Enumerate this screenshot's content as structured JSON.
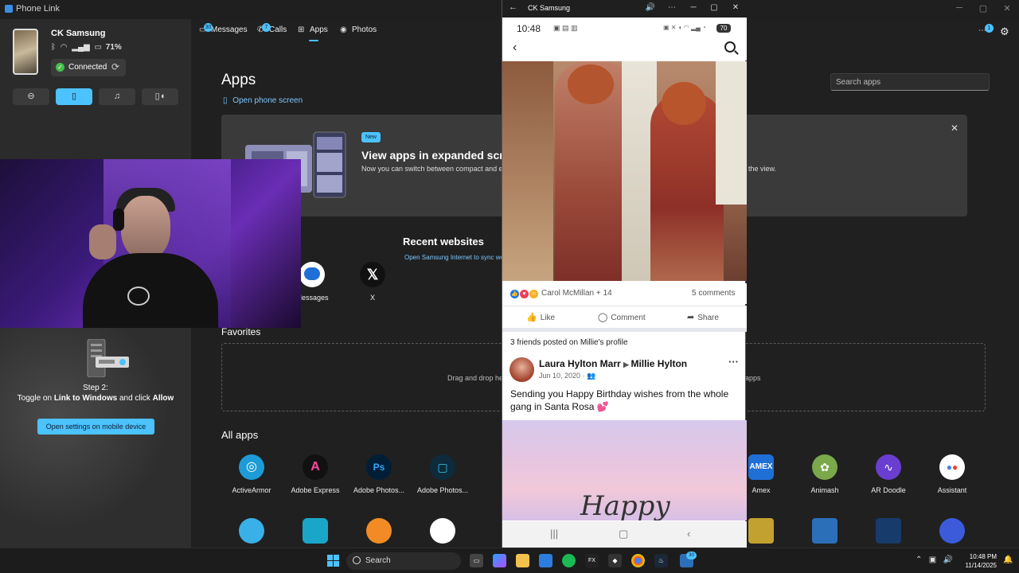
{
  "window": {
    "title": "Phone Link"
  },
  "device": {
    "name": "CK Samsung",
    "battery": "71%",
    "status": "Connected"
  },
  "nav": {
    "messages": "Messages",
    "messages_badge": "30",
    "calls": "Calls",
    "calls_badge": "7",
    "apps": "Apps",
    "photos": "Photos",
    "notif_badge": "1"
  },
  "setup": {
    "step_title": "Step 2:",
    "step_pre": "Toggle on ",
    "step_bold1": "Link to Windows",
    "step_mid": " and click ",
    "step_bold2": "Allow",
    "button": "Open settings on mobile device"
  },
  "main": {
    "title": "Apps",
    "open_phone_screen": "Open phone screen",
    "search_placeholder": "Search apps",
    "banner": {
      "badge": "New",
      "title": "View apps in expanded screen",
      "desc": "Now you can switch between compact and expanded",
      "desc_tail": "the view."
    },
    "recent": {
      "title": "Recent websites",
      "desc": "Open Samsung Internet to sync websites",
      "items": [
        "Messages",
        "X"
      ]
    },
    "favorites": {
      "title": "Favorites",
      "hint": "Drag and drop here",
      "hint_tail": "apps"
    },
    "all_apps_title": "All apps",
    "all_apps": [
      {
        "label": "ActiveArmor",
        "color": "#1e9bd7",
        "glyph": "◎"
      },
      {
        "label": "Adobe Express",
        "color": "#111111",
        "glyph": "A"
      },
      {
        "label": "Adobe Photos...",
        "color": "#001e36",
        "glyph": "Ps"
      },
      {
        "label": "Adobe Photos...",
        "color": "#0d2b3a",
        "glyph": "▢"
      },
      {
        "label": "Amex",
        "color": "#1f6fd6",
        "glyph": "AM"
      },
      {
        "label": "Animash",
        "color": "#7aa84a",
        "glyph": "✿"
      },
      {
        "label": "AR Doodle",
        "color": "#6a3ed0",
        "glyph": "~"
      },
      {
        "label": "Assistant",
        "color": "#ffffff",
        "glyph": "●"
      }
    ]
  },
  "phone": {
    "window_title": "CK Samsung",
    "time": "10:48",
    "battery": "70",
    "reactors": "Carol McMillan + 14",
    "comments": "5 comments",
    "like": "Like",
    "comment": "Comment",
    "share": "Share",
    "friends_posted": "3 friends posted on Millie's profile",
    "author_from": "Laura Hylton Marr",
    "author_to": "Millie Hylton",
    "date": "Jun 10, 2020 ·",
    "post_text": "Sending you Happy Birthday wishes from the whole gang in Santa Rosa 💕",
    "image_text": "Happy"
  },
  "taskbar": {
    "search": "Search",
    "time": "10:48 PM",
    "date": "11/14/2025",
    "badge": "30"
  }
}
